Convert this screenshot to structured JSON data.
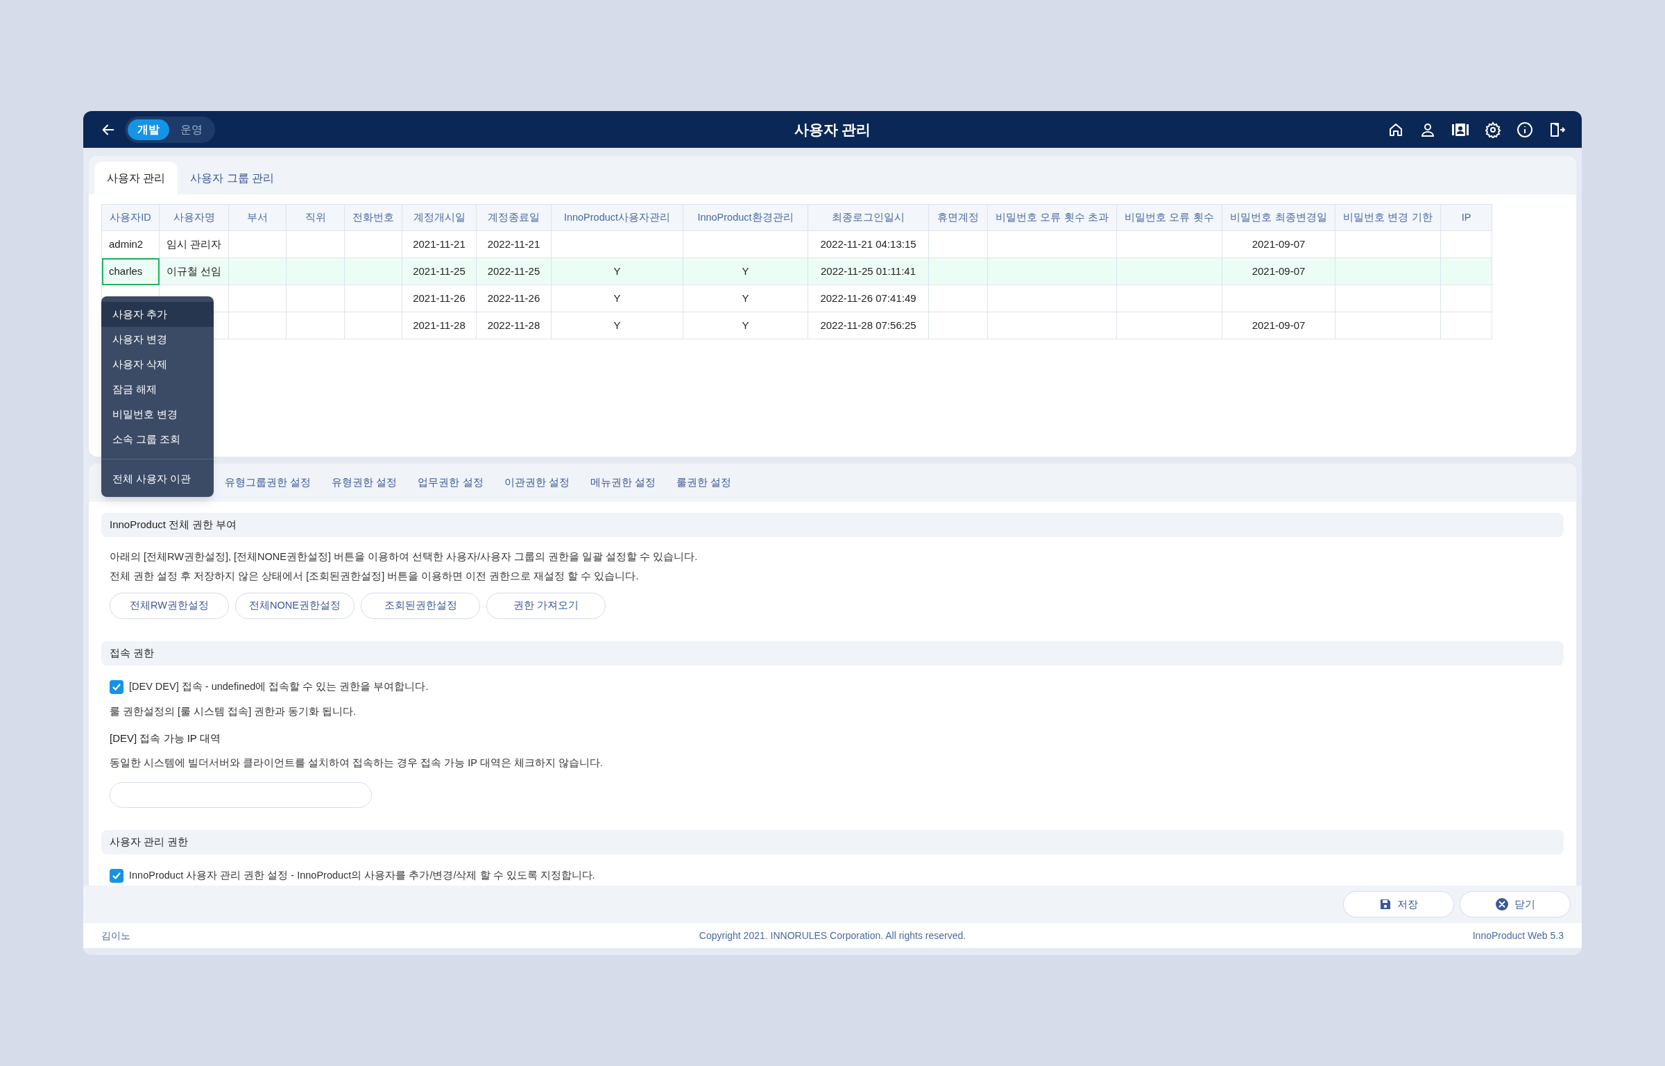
{
  "env_toggle": [
    {
      "label": "개발",
      "selected": true
    },
    {
      "label": "운영",
      "selected": false
    }
  ],
  "title": "사용자 관리",
  "top_tabs": [
    {
      "label": "사용자 관리",
      "selected": true
    },
    {
      "label": "사용자 그룹 관리",
      "selected": false
    }
  ],
  "table": {
    "columns": [
      "사용자ID",
      "사용자명",
      "부서",
      "직위",
      "전화번호",
      "계정개시일",
      "계정종료일",
      "InnoProduct사용자관리",
      "InnoProduct환경관리",
      "최종로그인일시",
      "휴면계정",
      "비밀번호 오류 횟수 초과",
      "비밀번호 오류 횟수",
      "비밀번호 최종변경일",
      "비밀번호 변경 기한",
      "IP"
    ],
    "rows": [
      {
        "selected": false,
        "cells": [
          "admin2",
          "임시 관리자",
          null,
          null,
          null,
          "2021-11-21",
          "2022-11-21",
          null,
          null,
          "2022-11-21 04:13:15",
          null,
          null,
          null,
          "2021-09-07",
          null,
          null
        ]
      },
      {
        "selected": true,
        "cells": [
          "charles",
          "이규철 선임",
          null,
          null,
          null,
          "2021-11-25",
          "2022-11-25",
          "Y",
          "Y",
          "2022-11-25 01:11:41",
          null,
          null,
          null,
          "2021-09-07",
          null,
          null
        ]
      },
      {
        "selected": false,
        "cells": [
          null,
          null,
          null,
          null,
          null,
          "2021-11-26",
          "2022-11-26",
          "Y",
          "Y",
          "2022-11-26 07:41:49",
          null,
          null,
          null,
          null,
          null,
          null
        ]
      },
      {
        "selected": false,
        "cells": [
          null,
          null,
          null,
          null,
          null,
          "2021-11-28",
          "2022-11-28",
          "Y",
          "Y",
          "2022-11-28 07:56:25",
          null,
          null,
          null,
          "2021-09-07",
          null,
          null
        ]
      }
    ]
  },
  "context_menu": {
    "groups": [
      {
        "items": [
          {
            "label": "사용자 추가",
            "selected": true
          },
          {
            "label": "사용자 변경",
            "selected": false
          },
          {
            "label": "사용자 삭제",
            "selected": false
          },
          {
            "label": "잠금 해제",
            "selected": false
          },
          {
            "label": "비밀번호 변경",
            "selected": false
          },
          {
            "label": "소속 그룹 조회",
            "selected": false
          }
        ]
      },
      {
        "items": [
          {
            "label": "전체 사용자 이관",
            "selected": false
          }
        ]
      }
    ]
  },
  "permission_tabs": [
    {
      "label": "유형그룹권한 설정",
      "selected": false
    },
    {
      "label": "유형권한 설정",
      "selected": false
    },
    {
      "label": "업무권한 설정",
      "selected": false
    },
    {
      "label": "이관권한 설정",
      "selected": false
    },
    {
      "label": "메뉴권한 설정",
      "selected": false
    },
    {
      "label": "룰권한 설정",
      "selected": false
    }
  ],
  "sections": [
    {
      "title": "InnoProduct 전체 권한 부여",
      "blocks": [
        {
          "kind": "paragraph",
          "lines": [
            "아래의 [전체RW권한설정], [전체NONE권한설정] 버튼을 이용하여 선택한 사용자/사용자 그룹의 권한을 일괄 설정할 수 있습니다.",
            "전체 권한 설정 후 저장하지 않은 상태에서 [조회된권한설정] 버튼을 이용하면 이전 권한으로 재설정 할 수 있습니다."
          ]
        },
        {
          "kind": "buttons",
          "items": [
            "전체RW권한설정",
            "전체NONE권한설정",
            "조회된권한설정",
            "권한 가져오기"
          ]
        }
      ]
    },
    {
      "title": "접속 권한",
      "blocks": [
        {
          "kind": "checkbox",
          "label": "[DEV DEV] 접속 - undefined에 접속할 수 있는 권한을 부여합니다.",
          "checked": true
        },
        {
          "kind": "note",
          "text": "룰 권한설정의 [룰 시스템 접속] 권한과 동기화 됩니다."
        },
        {
          "kind": "subheading",
          "text": "[DEV] 접속 가능 IP 대역"
        },
        {
          "kind": "note",
          "text": "동일한 시스템에 빌더서버와 클라이언트를 설치하여 접속하는 경우 접속 가능 IP 대역은 체크하지 않습니다."
        },
        {
          "kind": "field"
        }
      ]
    },
    {
      "title": "사용자 관리 권한",
      "blocks": [
        {
          "kind": "checkbox",
          "label": "InnoProduct 사용자 관리 권한 설정 - InnoProduct의 사용자를 추가/변경/삭제 할 수 있도록 지정합니다.",
          "checked": true
        }
      ]
    }
  ],
  "footer_buttons": [
    {
      "kind": "save",
      "label": "저장"
    },
    {
      "kind": "close",
      "label": "닫기"
    }
  ],
  "status_bar": {
    "user": "김이노",
    "copyright": "Copyright 2021. INNORULES Corporation. All rights reserved.",
    "version": "InnoProduct Web 5.3"
  }
}
